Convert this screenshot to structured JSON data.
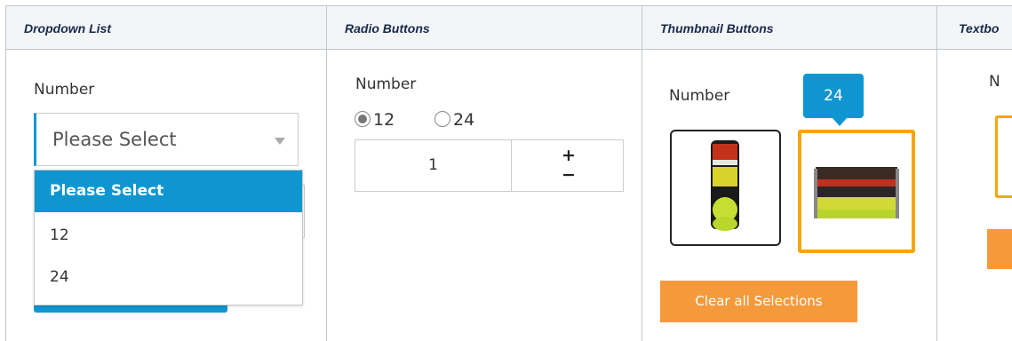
{
  "headers": [
    "Dropdown List",
    "Radio Buttons",
    "Thumbnail Buttons",
    "Textbo"
  ],
  "dropdown": {
    "label": "Number",
    "selected": "Please Select",
    "options": [
      "Please Select",
      "12",
      "24"
    ]
  },
  "radio": {
    "label": "Number",
    "options": [
      "12",
      "24"
    ],
    "selected": "12",
    "quantity": "1",
    "plus": "+",
    "minus": "−"
  },
  "thumbnails": {
    "label": "Number",
    "tooltip": "24",
    "items": [
      {
        "name": "single can of tennis balls"
      },
      {
        "name": "case of 24 tennis ball cans"
      }
    ],
    "clear_label": "Clear all Selections"
  },
  "textbox": {
    "label": "N"
  },
  "colors": {
    "accent": "#0f96d1",
    "orange": "#f59a3b",
    "selected_border": "#f5a70a"
  }
}
